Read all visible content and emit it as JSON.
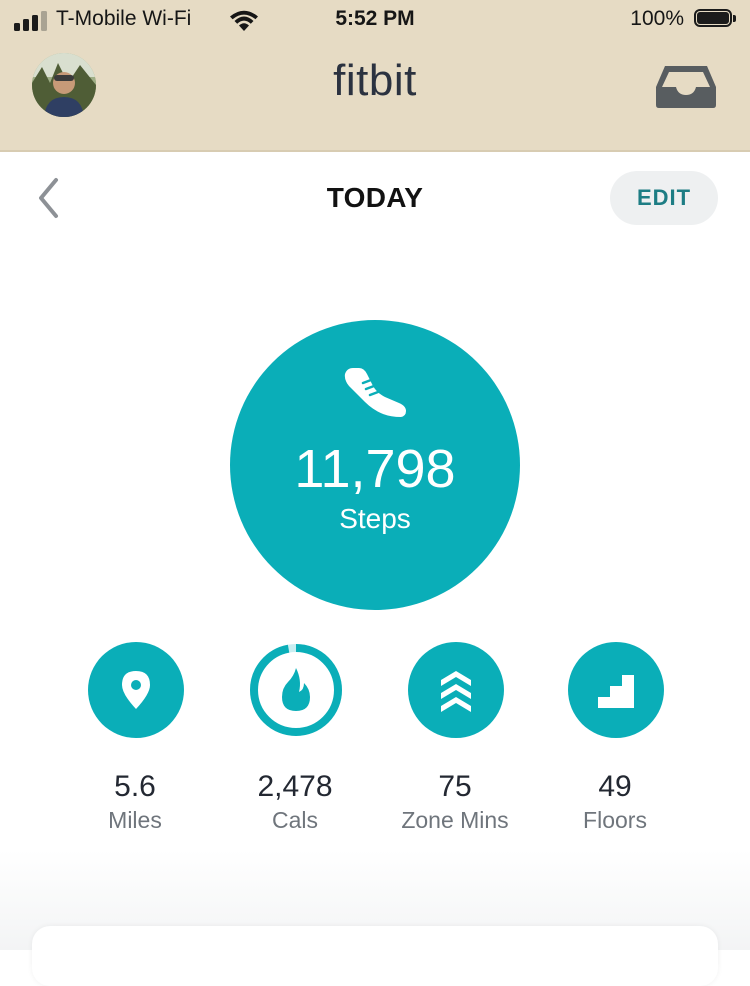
{
  "status_bar": {
    "carrier": "T-Mobile Wi-Fi",
    "time": "5:52 PM",
    "battery": "100%",
    "signal_bars_active": 3,
    "signal_bars_total": 4
  },
  "header": {
    "app_title": "fitbit",
    "avatar_icon": "profile-photo",
    "inbox_icon": "inbox-tray-icon"
  },
  "nav": {
    "back_icon": "chevron-left-icon",
    "title": "TODAY",
    "edit_label": "EDIT"
  },
  "steps": {
    "icon": "shoe-icon",
    "value": "11,798",
    "label": "Steps"
  },
  "stats": [
    {
      "icon": "location-pin-icon",
      "value": "5.6",
      "label": "Miles"
    },
    {
      "icon": "flame-icon",
      "value": "2,478",
      "label": "Cals",
      "progress": 0.97
    },
    {
      "icon": "zone-chevrons-icon",
      "value": "75",
      "label": "Zone Mins"
    },
    {
      "icon": "stairs-icon",
      "value": "49",
      "label": "Floors"
    }
  ],
  "colors": {
    "accent": "#0aaeb8",
    "header_bg": "#e6dbc4",
    "edit_text": "#1d7d84"
  }
}
